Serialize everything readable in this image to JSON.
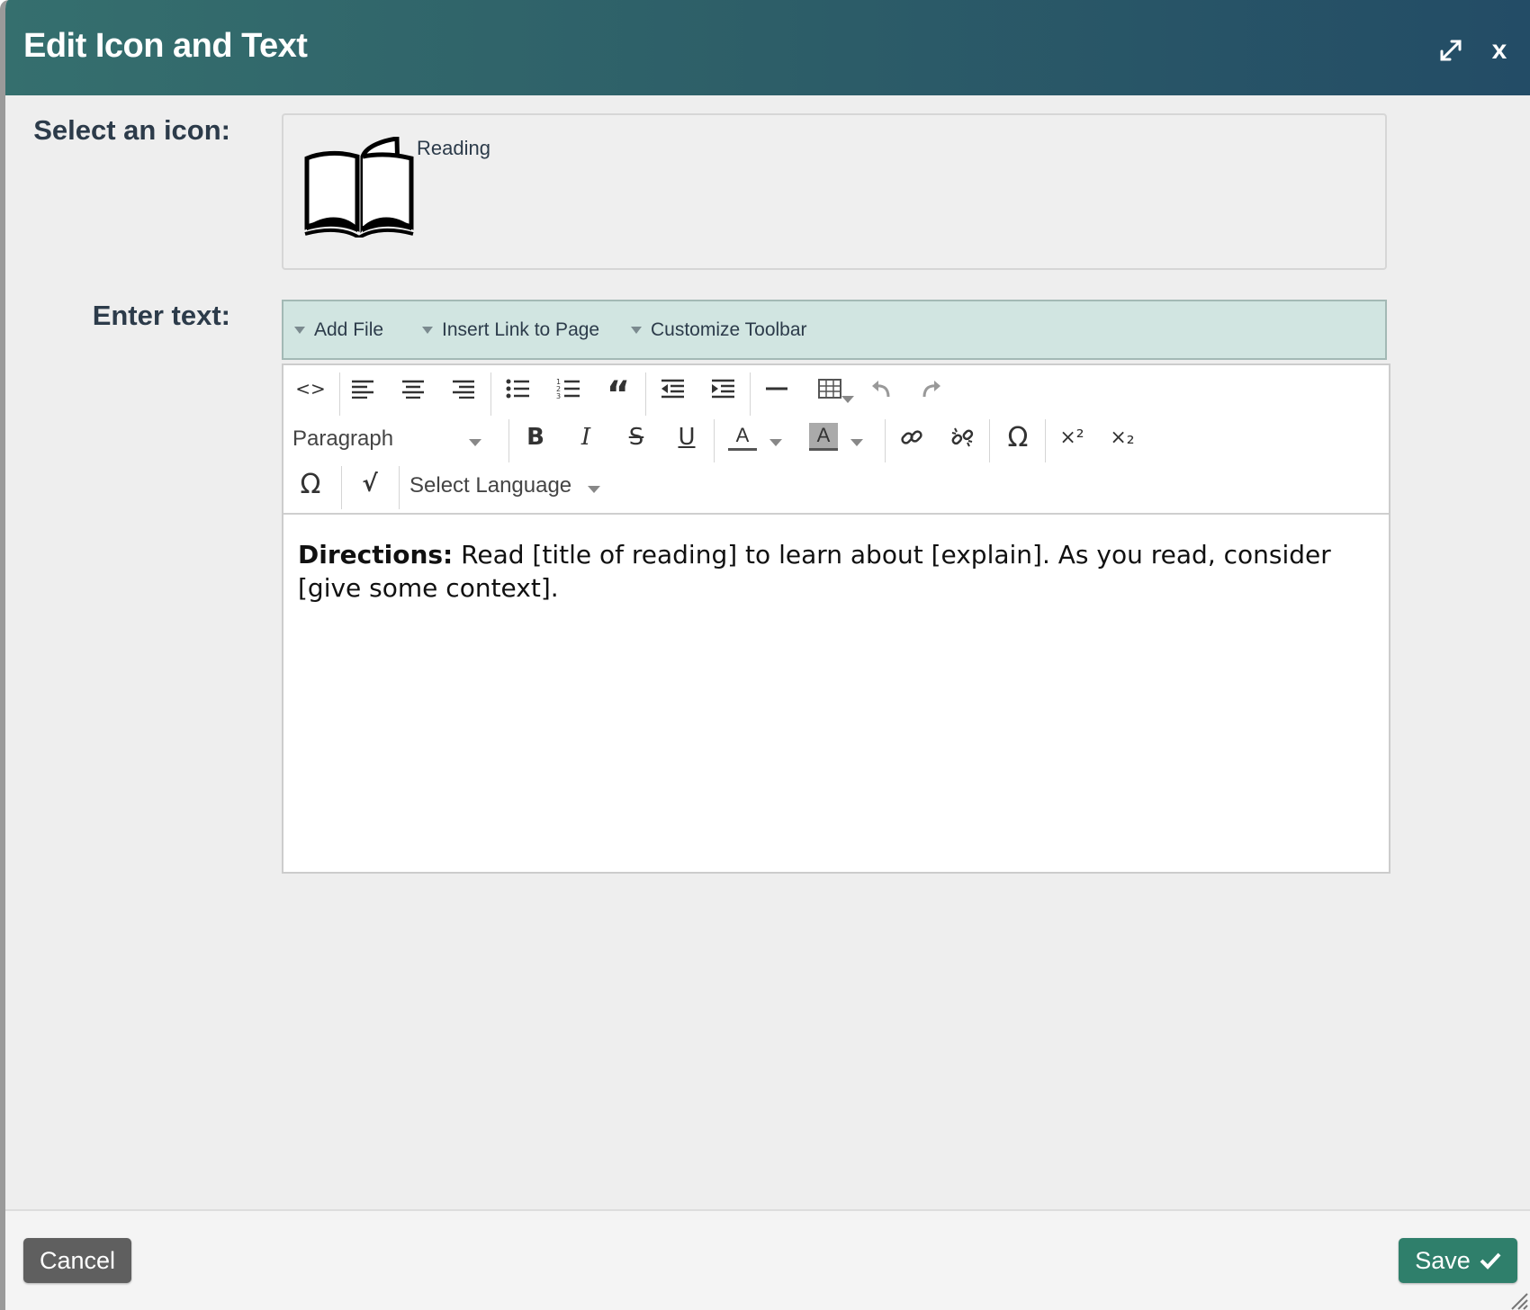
{
  "dialog": {
    "title": "Edit Icon and Text",
    "expand_icon": "expand-icon",
    "close_label": "x"
  },
  "icon_field": {
    "label": "Select an icon:",
    "selected_icon": "book-icon",
    "selected_name": "Reading"
  },
  "text_field": {
    "label": "Enter text:"
  },
  "addon_bar": {
    "items": [
      "Add File",
      "Insert Link to Page",
      "Customize Toolbar"
    ]
  },
  "toolbar": {
    "row1": [
      "source-code",
      "align-left",
      "align-center",
      "align-right",
      "bullet-list",
      "numbered-list",
      "blockquote",
      "outdent",
      "indent",
      "horizontal-rule",
      "table",
      "undo",
      "redo"
    ],
    "paragraph_select": "Paragraph",
    "row2": [
      "bold",
      "italic",
      "strikethrough",
      "underline",
      "text-color",
      "background-color",
      "link",
      "unlink",
      "special-character",
      "superscript",
      "subscript"
    ],
    "row3": [
      "omega",
      "math"
    ],
    "language_select": "Select Language"
  },
  "editor_content": {
    "lead": "Directions:",
    "body": " Read [title of reading] to learn about [explain]. As you read, consider [give some context]."
  },
  "footer": {
    "cancel_label": "Cancel",
    "save_label": "Save"
  },
  "colors": {
    "title_gradient_start": "#356f6e",
    "title_gradient_end": "#234c66",
    "addon_bar": "#d1e5e1",
    "save_button": "#2f7f6b",
    "cancel_button": "#5f5f5f"
  }
}
